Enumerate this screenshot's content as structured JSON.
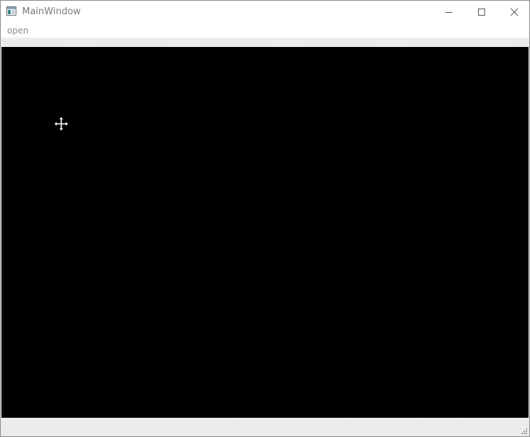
{
  "window": {
    "title": "MainWindow",
    "icon": "window-app-icon"
  },
  "caption_buttons": {
    "minimize_icon": "minimize-icon",
    "maximize_icon": "maximize-icon",
    "close_icon": "close-icon"
  },
  "menubar": {
    "items": [
      {
        "label": "open"
      }
    ]
  },
  "canvas": {
    "background": "#000000",
    "cursor_icon": "move-cursor-icon"
  },
  "colors": {
    "title_text": "#7a7a7a",
    "menu_text": "#8a8a8a",
    "canvas": "#000000",
    "chrome": "#f0f0f0"
  }
}
